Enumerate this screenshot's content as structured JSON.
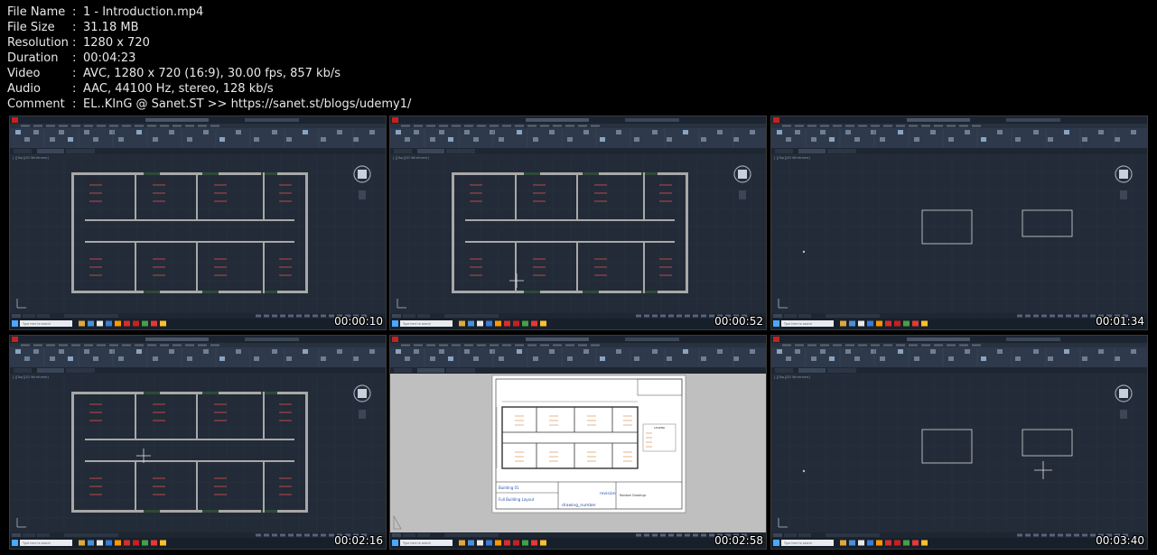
{
  "info": {
    "rows": [
      {
        "key": "File Name",
        "value": "1 - Introduction.mp4"
      },
      {
        "key": "File Size",
        "value": "31.18 MB"
      },
      {
        "key": "Resolution",
        "value": "1280 x 720"
      },
      {
        "key": "Duration",
        "value": "00:04:23"
      },
      {
        "key": "Video",
        "value": "AVC, 1280 x 720 (16:9), 30.00 fps, 857 kb/s"
      },
      {
        "key": "Audio",
        "value": "AAC, 44100 Hz, stereo, 128 kb/s"
      },
      {
        "key": "Comment",
        "value": "EL..KInG @ Sanet.ST >> https://sanet.st/blogs/udemy1/"
      }
    ]
  },
  "thumbnails": [
    {
      "timestamp": "00:00:10",
      "scene": "floorplan"
    },
    {
      "timestamp": "00:00:52",
      "scene": "floorplan"
    },
    {
      "timestamp": "00:01:34",
      "scene": "rectangles"
    },
    {
      "timestamp": "00:02:16",
      "scene": "floorplan"
    },
    {
      "timestamp": "00:02:58",
      "scene": "layout"
    },
    {
      "timestamp": "00:03:40",
      "scene": "rectangles"
    }
  ],
  "layout_sheet": {
    "drawing_title": "Building 01",
    "sheet_title": "Full Building Layout",
    "drawing_number": "drawing_number",
    "revision": "revision",
    "legend": "LEGEND",
    "project": "Random Drawings"
  },
  "colors": {
    "viewport": "#222b37",
    "ribbon": "#2e3a4b",
    "wall": "#a8a8a8",
    "dimension": "#b94a4a"
  }
}
